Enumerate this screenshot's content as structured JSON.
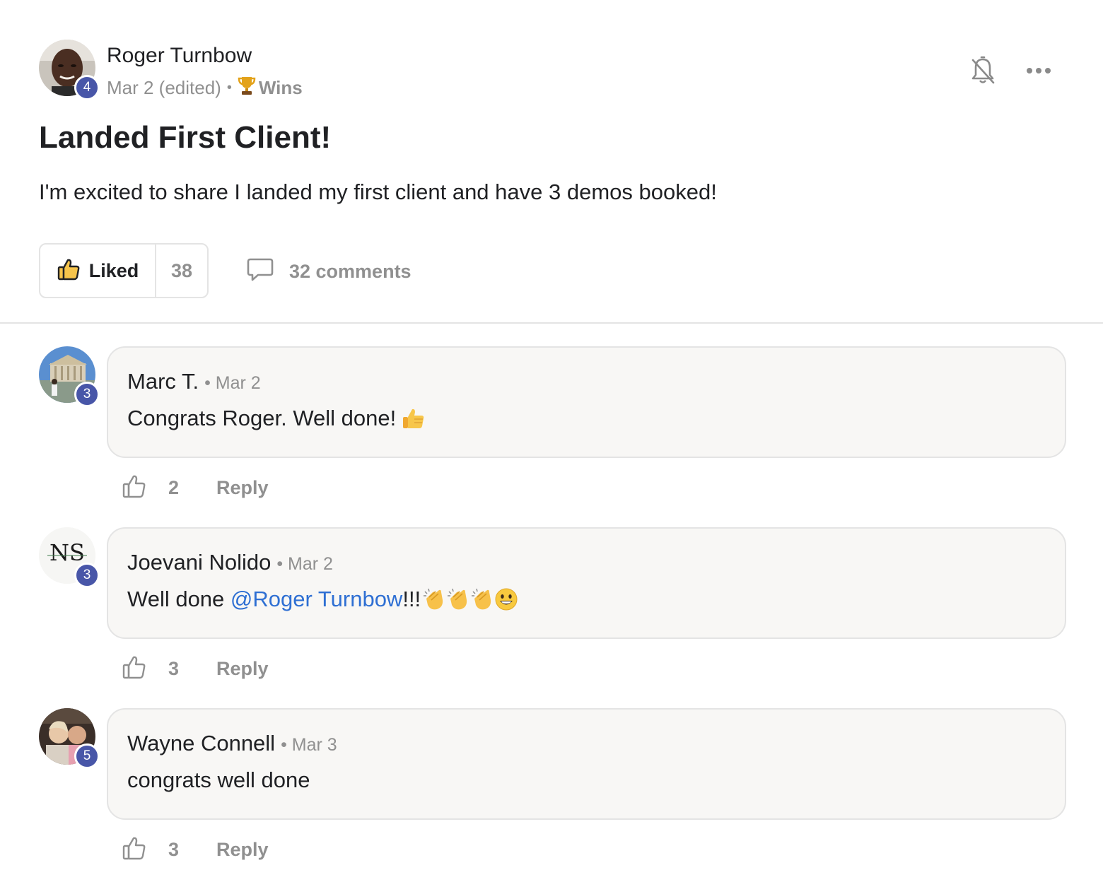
{
  "post": {
    "author": {
      "name": "Roger Turnbow",
      "level": "4",
      "avatar_icon": "user-photo-avatar"
    },
    "date": "Mar 2 (edited)",
    "separator": "•",
    "category": {
      "label": "Wins",
      "icon": "trophy-icon"
    },
    "title": "Landed First Client!",
    "body": "I'm excited to share I landed my first client and have 3 demos booked!",
    "actions": {
      "like_label": "Liked",
      "like_count": "38",
      "comments_label": "32 comments"
    },
    "header_icons": [
      "bell-off-icon",
      "more-options-icon"
    ]
  },
  "comments": [
    {
      "name": "Marc T.",
      "meta": "• Mar 2",
      "level": "3",
      "text": "Congrats Roger. Well done!",
      "emojis": [
        "thumbs-up-emoji"
      ],
      "likes": "2",
      "reply_label": "Reply"
    },
    {
      "name": "Joevani Nolido",
      "meta": "• Mar 2",
      "level": "3",
      "avatar_logo": "NS",
      "text_before": "Well done ",
      "mention": "@Roger Turnbow",
      "text_after": "!!!",
      "emojis": [
        "clapping-hands-emoji",
        "clapping-hands-emoji",
        "clapping-hands-emoji",
        "grinning-face-emoji"
      ],
      "likes": "3",
      "reply_label": "Reply"
    },
    {
      "name": "Wayne Connell",
      "meta": "• Mar 3",
      "level": "5",
      "text": "congrats well done",
      "likes": "3",
      "reply_label": "Reply"
    }
  ],
  "colors": {
    "level_badge": "#4856a8",
    "mention": "#2e6fd3",
    "muted_text": "#909090",
    "bubble_bg": "#f8f7f5",
    "border": "#e4e4e4"
  }
}
